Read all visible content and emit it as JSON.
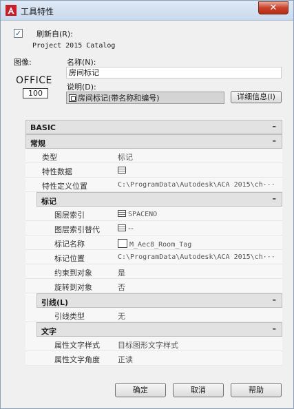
{
  "window": {
    "title": "工具特性",
    "close_glyph": "✕"
  },
  "refresh": {
    "checked": true,
    "label": "刷新自(R):",
    "source": "Project 2015 Catalog"
  },
  "image": {
    "label": "图像:",
    "office_text": "OFFICE",
    "office_number": "100"
  },
  "name": {
    "label": "名称(N):",
    "value": "房间标记"
  },
  "description": {
    "label": "说明(D):",
    "value": "房间标记(带名称和编号)",
    "detail_button": "详细信息(I)"
  },
  "grid": {
    "basic": {
      "label": "BASIC",
      "toggle": "–"
    },
    "general": {
      "label": "常规",
      "toggle": "–",
      "rows": [
        {
          "name": "类型",
          "value": "标记"
        },
        {
          "name": "特性数据",
          "value": "",
          "icon": "table-icon"
        },
        {
          "name": "特性定义位置",
          "value": "C:\\ProgramData\\Autodesk\\ACA  2015\\ch···"
        }
      ]
    },
    "tag": {
      "label": "标记",
      "toggle": "–",
      "rows": [
        {
          "name": "图层索引",
          "value": "SPACENO",
          "icon": "table-icon"
        },
        {
          "name": "图层索引替代",
          "value": "--",
          "icon": "table-icon"
        },
        {
          "name": "标记名称",
          "value": "M_Aec8_Room_Tag",
          "icon": "tag-icon"
        },
        {
          "name": "标记位置",
          "value": "C:\\ProgramData\\Autodesk\\ACA  2015\\ch···"
        },
        {
          "name": "约束到对象",
          "value": "是"
        },
        {
          "name": "旋转到对象",
          "value": "否"
        }
      ]
    },
    "leader": {
      "label": "引线(L)",
      "toggle": "–",
      "rows": [
        {
          "name": "引线类型",
          "value": "无"
        }
      ]
    },
    "text": {
      "label": "文字",
      "toggle": "–",
      "rows": [
        {
          "name": "属性文字样式",
          "value": "目标图形文字样式"
        },
        {
          "name": "属性文字角度",
          "value": "正读"
        }
      ]
    }
  },
  "buttons": {
    "ok": "确定",
    "cancel": "取消",
    "help": "帮助"
  }
}
